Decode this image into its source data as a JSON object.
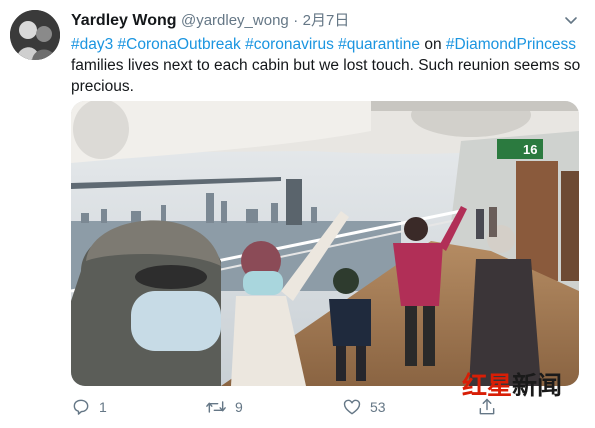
{
  "tweet": {
    "author_name": "Yardley Wong",
    "handle": "@yardley_wong",
    "separator": "·",
    "date": "2月7日",
    "text_parts": [
      {
        "text": "#day3",
        "hashtag": true
      },
      {
        "text": " ",
        "hashtag": false
      },
      {
        "text": "#CoronaOutbreak",
        "hashtag": true
      },
      {
        "text": " ",
        "hashtag": false
      },
      {
        "text": "#coronavirus",
        "hashtag": true
      },
      {
        "text": " ",
        "hashtag": false
      },
      {
        "text": "#quarantine",
        "hashtag": true
      },
      {
        "text": " on ",
        "hashtag": false
      },
      {
        "text": "#DiamondPrincess",
        "hashtag": true
      },
      {
        "text": " families lives next to each cabin but we lost touch. Such reunion seems so precious.",
        "hashtag": false
      }
    ],
    "photo": {
      "deck_sign": "16"
    },
    "actions": {
      "reply_count": "1",
      "retweet_count": "9",
      "like_count": "53"
    }
  },
  "watermark": {
    "red_part": "红星",
    "black_part": "新闻"
  },
  "colors": {
    "hashtag": "#1b95e0",
    "muted": "#657786",
    "watermark_red": "#d81e06"
  },
  "icons": [
    "avatar",
    "chevron-down-icon",
    "reply-icon",
    "retweet-icon",
    "like-icon",
    "share-icon"
  ]
}
